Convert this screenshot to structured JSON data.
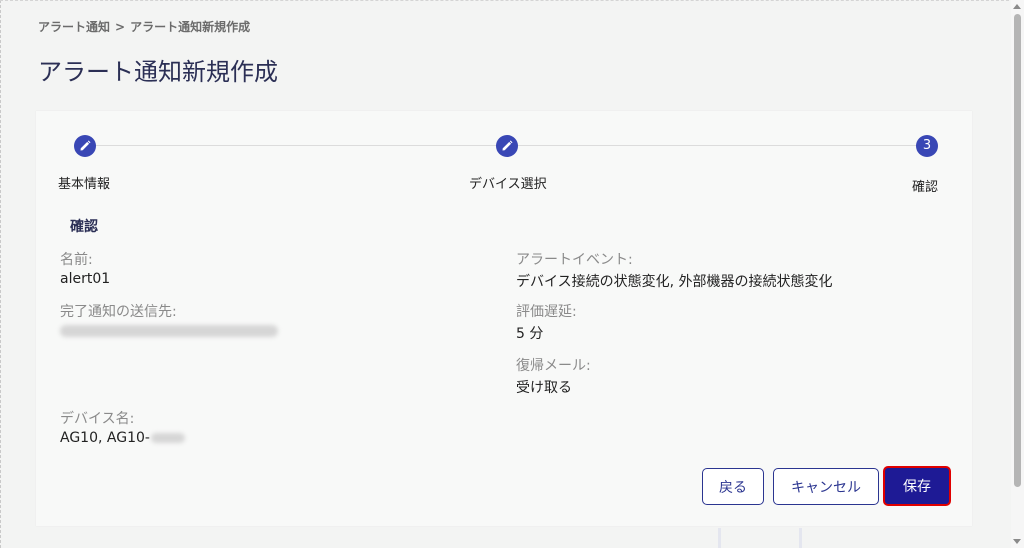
{
  "breadcrumb": {
    "parent": "アラート通知",
    "separator": ">",
    "current": "アラート通知新規作成"
  },
  "page": {
    "title": "アラート通知新規作成"
  },
  "stepper": {
    "steps": [
      {
        "label": "基本情報",
        "state": "done",
        "icon": "pencil-icon"
      },
      {
        "label": "デバイス選択",
        "state": "done",
        "icon": "pencil-icon"
      },
      {
        "label": "確認",
        "state": "active",
        "number": "3"
      }
    ],
    "accent_color": "#3947b5"
  },
  "confirm": {
    "section_title": "確認",
    "name_label": "名前:",
    "name_value": "alert01",
    "completion_label": "完了通知の送信先:",
    "device_label": "デバイス名:",
    "device_value": "AG10, AG10-",
    "event_label": "アラートイベント:",
    "event_value": "デバイス接続の状態変化, 外部機器の接続状態変化",
    "delay_label": "評価遅延:",
    "delay_value": "5 分",
    "recovery_label": "復帰メール:",
    "recovery_value": "受け取る"
  },
  "actions": {
    "back_label": "戻る",
    "cancel_label": "キャンセル",
    "save_label": "保存",
    "primary_color": "#1e1a95",
    "highlight_color": "#e00000"
  }
}
